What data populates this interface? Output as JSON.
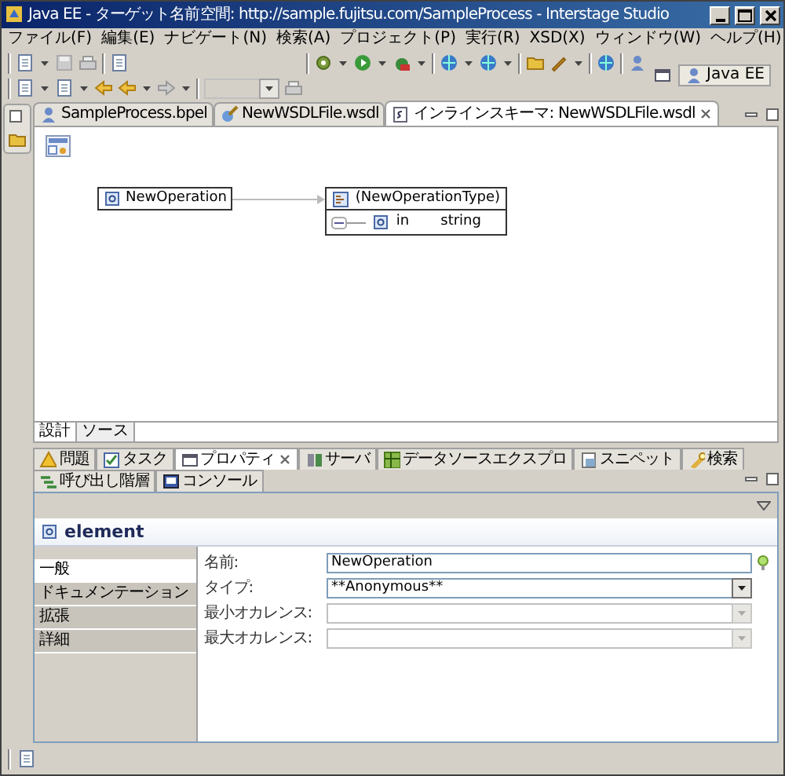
{
  "window": {
    "title": "Java EE - ターゲット名前空間: http://sample.fujitsu.com/SampleProcess - Interstage Studio"
  },
  "menu": [
    "ファイル(F)",
    "編集(E)",
    "ナビゲート(N)",
    "検索(A)",
    "プロジェクト(P)",
    "実行(R)",
    "XSD(X)",
    "ウィンドウ(W)",
    "ヘルプ(H)"
  ],
  "perspective": {
    "label": "Java EE",
    "selected": true
  },
  "editor_tabs": [
    {
      "label": "SampleProcess.bpel",
      "selected": false
    },
    {
      "label": "NewWSDLFile.wsdl",
      "selected": false
    },
    {
      "label": "インラインスキーマ: NewWSDLFile.wsdl",
      "selected": true
    }
  ],
  "diagram": {
    "element": "NewOperation",
    "type": "(NewOperationType)",
    "child": {
      "name": "in",
      "type": "string"
    }
  },
  "editor_mode_tabs": [
    {
      "label": "設計",
      "selected": true
    },
    {
      "label": "ソース",
      "selected": false
    }
  ],
  "view_tabs": [
    {
      "label": "問題",
      "selected": false
    },
    {
      "label": "タスク",
      "selected": false
    },
    {
      "label": "プロパティ",
      "selected": true
    },
    {
      "label": "サーバ",
      "selected": false
    },
    {
      "label": "データソースエクスプロ",
      "selected": false
    },
    {
      "label": "スニペット",
      "selected": false
    },
    {
      "label": "検索",
      "selected": false
    },
    {
      "label": "呼び出し階層",
      "selected": false
    },
    {
      "label": "コンソール",
      "selected": false
    }
  ],
  "properties": {
    "title": "element",
    "sections": [
      {
        "label": "一般",
        "selected": true
      },
      {
        "label": "ドキュメンテーション",
        "selected": false
      },
      {
        "label": "拡張",
        "selected": false
      },
      {
        "label": "詳細",
        "selected": false
      }
    ],
    "fields": [
      {
        "label": "名前:",
        "kind": "text",
        "value": "NewOperation",
        "disabled": false
      },
      {
        "label": "タイプ:",
        "kind": "combo",
        "value": "**Anonymous**",
        "disabled": false
      },
      {
        "label": "最小オカレンス:",
        "kind": "combo",
        "disabled": true
      },
      {
        "label": "最大オカレンス:",
        "kind": "combo",
        "disabled": true
      }
    ]
  }
}
